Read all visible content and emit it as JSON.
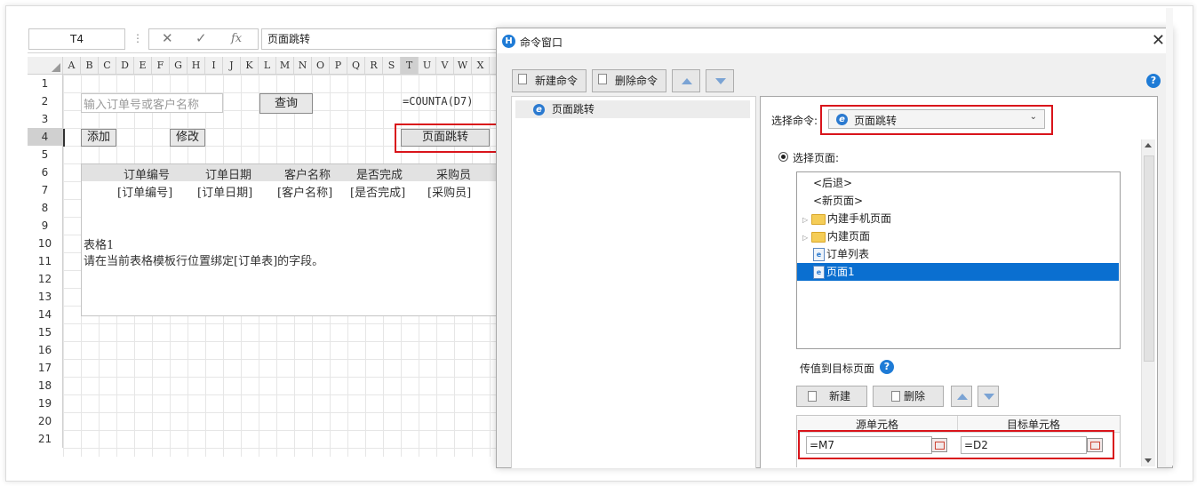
{
  "spreadsheet": {
    "name_box": "T4",
    "formula_icons": {
      "cancel": "close-x",
      "confirm": "check",
      "fx": "fx"
    },
    "formula_text": "页面跳转",
    "columns": [
      "A",
      "B",
      "C",
      "D",
      "E",
      "F",
      "G",
      "H",
      "I",
      "J",
      "K",
      "L",
      "M",
      "N",
      "O",
      "P",
      "Q",
      "R",
      "S",
      "T",
      "U",
      "V",
      "W",
      "X"
    ],
    "selected_column": "T",
    "rows": [
      "1",
      "2",
      "3",
      "4",
      "5",
      "6",
      "7",
      "8",
      "9",
      "10",
      "11",
      "12",
      "13",
      "14",
      "15",
      "16",
      "17",
      "18",
      "19",
      "20",
      "21"
    ],
    "search_placeholder": "输入订单号或客户名称",
    "query_button": "查询",
    "counta_formula": "=COUNTA(D7)",
    "add_button": "添加",
    "edit_button": "修改",
    "page_jump_button": "页面跳转",
    "table_headers": [
      "订单编号",
      "订单日期",
      "客户名称",
      "是否完成",
      "采购员"
    ],
    "table_fields": [
      "[订单编号]",
      "[订单日期]",
      "[客户名称]",
      "[是否完成]",
      "[采购员]"
    ],
    "template_title": "表格1",
    "template_hint": "请在当前表格模板行位置绑定[订单表]的字段。"
  },
  "dialog": {
    "title": "命令窗口",
    "close_icon": "close-x",
    "new_command": "新建命令",
    "delete_command": "删除命令",
    "command_list": [
      "页面跳转"
    ],
    "select_command_label": "选择命令:",
    "selected_command": "页面跳转",
    "select_page_label": "选择页面:",
    "pages": [
      {
        "label": "<后退>",
        "type": "text"
      },
      {
        "label": "<新页面>",
        "type": "text"
      },
      {
        "label": "内建手机页面",
        "type": "folder"
      },
      {
        "label": "内建页面",
        "type": "folder"
      },
      {
        "label": "订单列表",
        "type": "page"
      },
      {
        "label": "页面1",
        "type": "page",
        "selected": true
      }
    ],
    "pass_value_label": "传值到目标页面",
    "new_button": "新建",
    "delete_button": "删除",
    "grid_headers": [
      "源单元格",
      "目标单元格"
    ],
    "source_cell": "=M7",
    "target_cell": "=D2"
  },
  "colors": {
    "accent": "#0a6fd0",
    "highlight": "#d9141b",
    "logo": "#1e7bd6"
  }
}
